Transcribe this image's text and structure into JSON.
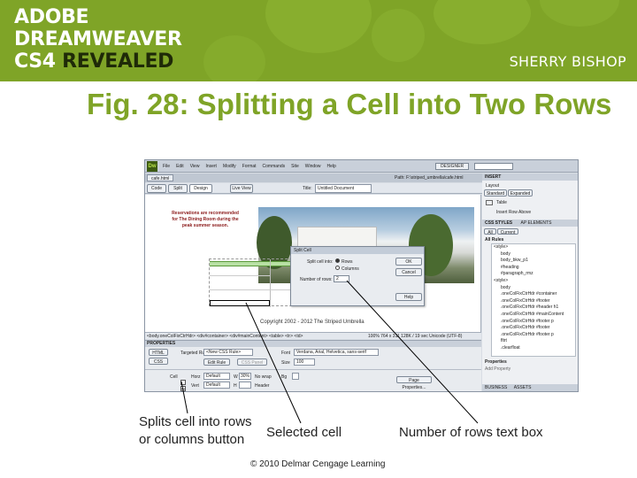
{
  "banner": {
    "logo_lines": [
      "ADOBE",
      "DREAMWEAVER"
    ],
    "logo_cs": "CS4",
    "logo_revealed": "REVEALED",
    "author": "SHERRY BISHOP"
  },
  "slide": {
    "title": "Fig. 28: Splitting a Cell into Two Rows"
  },
  "app": {
    "logo": "Dw",
    "menu": [
      "File",
      "Edit",
      "View",
      "Insert",
      "Modify",
      "Format",
      "Commands",
      "Site",
      "Window",
      "Help"
    ],
    "workspace": "DESIGNER",
    "doc_tab": "cafe.html",
    "path": "Path: F:\\striped_umbrella\\cafe.html",
    "views": [
      "Code",
      "Split",
      "Design"
    ],
    "live_view": "Live View",
    "title_label": "Title:",
    "title_value": "Untitled Document",
    "reservation_text": "Reservations are recommended for The Dining Room during the peak summer season.",
    "copyright_text": "Copyright 2002 - 2012 The Striped Umbrella",
    "tag_selector": "<body.oneColFixCtrHdr> <div#container> <div#mainContent> <table> <tr> <td>",
    "status_right": "100%  764 x 311  128K / 19 sec  Unicode (UTF-8)",
    "properties_title": "PROPERTIES",
    "prop_html": "HTML",
    "prop_css": "CSS",
    "targeted_rule_label": "Targeted Rule",
    "targeted_rule_value": "<New CSS Rule>",
    "edit_rule": "Edit Rule",
    "css_panel": "CSS Panel",
    "font_label": "Font",
    "font_value": "Verdana, Arial, Helvetica, sans-serif",
    "size_label": "Size",
    "size_value": "100",
    "page_properties": "Page Properties...",
    "cell_label": "Cell",
    "horz_label": "Horz",
    "horz_value": "Default",
    "vert_label": "Vert",
    "vert_value": "Default",
    "w_label": "W",
    "w_value": "30%",
    "h_label": "H",
    "nowrap_label": "No wrap",
    "header_label": "Header",
    "bg_label": "Bg",
    "right_panel": {
      "insert_tab": "INSERT",
      "layout_label": "Layout",
      "standard": "Standard",
      "expanded": "Expanded",
      "table": "Table",
      "insert_row_above": "Insert Row Above",
      "css_styles_tab": "CSS STYLES",
      "ap_elements_tab": "AP ELEMENTS",
      "all_tab": "All",
      "current_tab": "Current",
      "all_rules": "All Rules",
      "rules": [
        "<style>",
        "body",
        "body_bkw_p1",
        "#heading",
        "#paragraph_rmz",
        "<style>",
        "body",
        ".oneColFixCtrHdr #container",
        ".oneColFixCtrHdr #footer",
        ".oneColFixCtrHdr #header h1",
        ".oneColFixCtrHdr #mainContent",
        ".oneColFixCtrHdr #footer p",
        ".oneColFixCtrHdr #footer",
        ".oneColFixCtrHdr #footer p",
        "fltrt",
        ".clearfloat"
      ],
      "properties_label": "Properties",
      "add_property": "Add Property",
      "business_tab": "BUSINESS",
      "assets_tab": "ASSETS"
    },
    "dialog": {
      "title": "Split Cell",
      "split_into_label": "Split cell into:",
      "option_rows": "Rows",
      "option_columns": "Columns",
      "rows_label": "Number of rows:",
      "rows_value": "2",
      "ok": "OK",
      "cancel": "Cancel",
      "help": "Help"
    }
  },
  "callouts": {
    "split_button": "Splits cell into rows or columns button",
    "selected_cell": "Selected cell",
    "rows_box": "Number of rows text box"
  },
  "footer": {
    "copyright": "© 2010 Delmar Cengage Learning"
  },
  "colors": {
    "brand_green": "#7fa427",
    "dark_logo": "#1f2a08",
    "app_chrome": "#d8dde4",
    "dw_logo": "#3d5a12"
  }
}
